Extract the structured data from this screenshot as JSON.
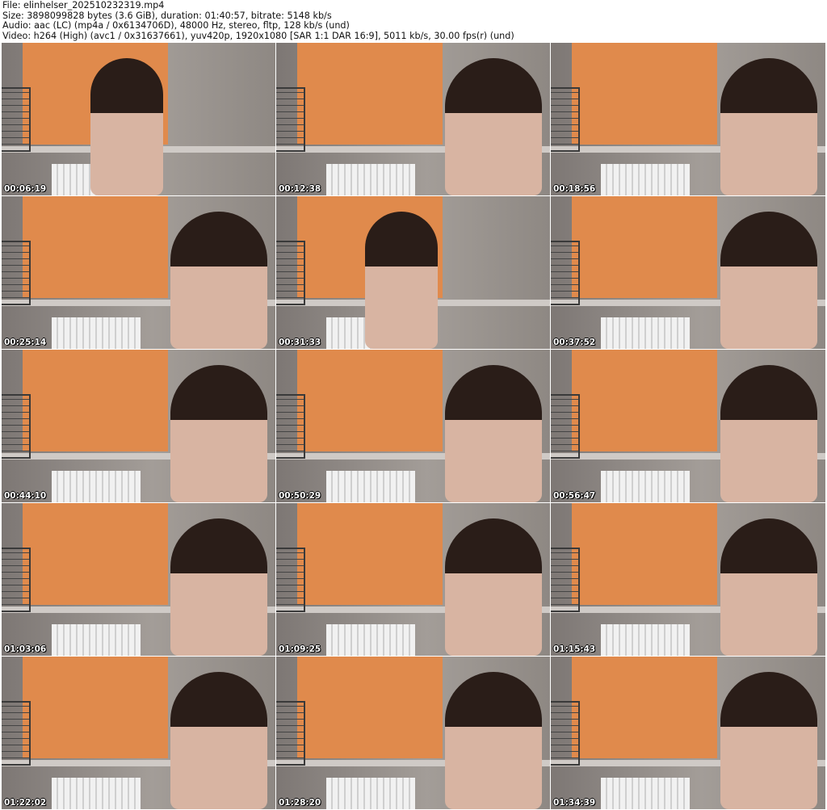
{
  "header": {
    "file": "File: elinhelser_202510232319.mp4",
    "size": "Size: 3898099828 bytes (3.6 GiB), duration: 01:40:57, bitrate: 5148 kb/s",
    "audio": "Audio: aac (LC) (mp4a / 0x6134706D), 48000 Hz, stereo, fltp, 128 kb/s (und)",
    "video": "Video: h264 (High) (avc1 / 0x31637661), yuv420p, 1920x1080 [SAR 1:1 DAR 16:9], 5011 kb/s, 30.00 fps(r) (und)"
  },
  "thumbnails": [
    {
      "timestamp": "00:06:19"
    },
    {
      "timestamp": "00:12:38"
    },
    {
      "timestamp": "00:18:56"
    },
    {
      "timestamp": "00:25:14"
    },
    {
      "timestamp": "00:31:33"
    },
    {
      "timestamp": "00:37:52"
    },
    {
      "timestamp": "00:44:10"
    },
    {
      "timestamp": "00:50:29"
    },
    {
      "timestamp": "00:56:47"
    },
    {
      "timestamp": "01:03:06"
    },
    {
      "timestamp": "01:09:25"
    },
    {
      "timestamp": "01:15:43"
    },
    {
      "timestamp": "01:22:02"
    },
    {
      "timestamp": "01:28:20"
    },
    {
      "timestamp": "01:34:39"
    }
  ]
}
